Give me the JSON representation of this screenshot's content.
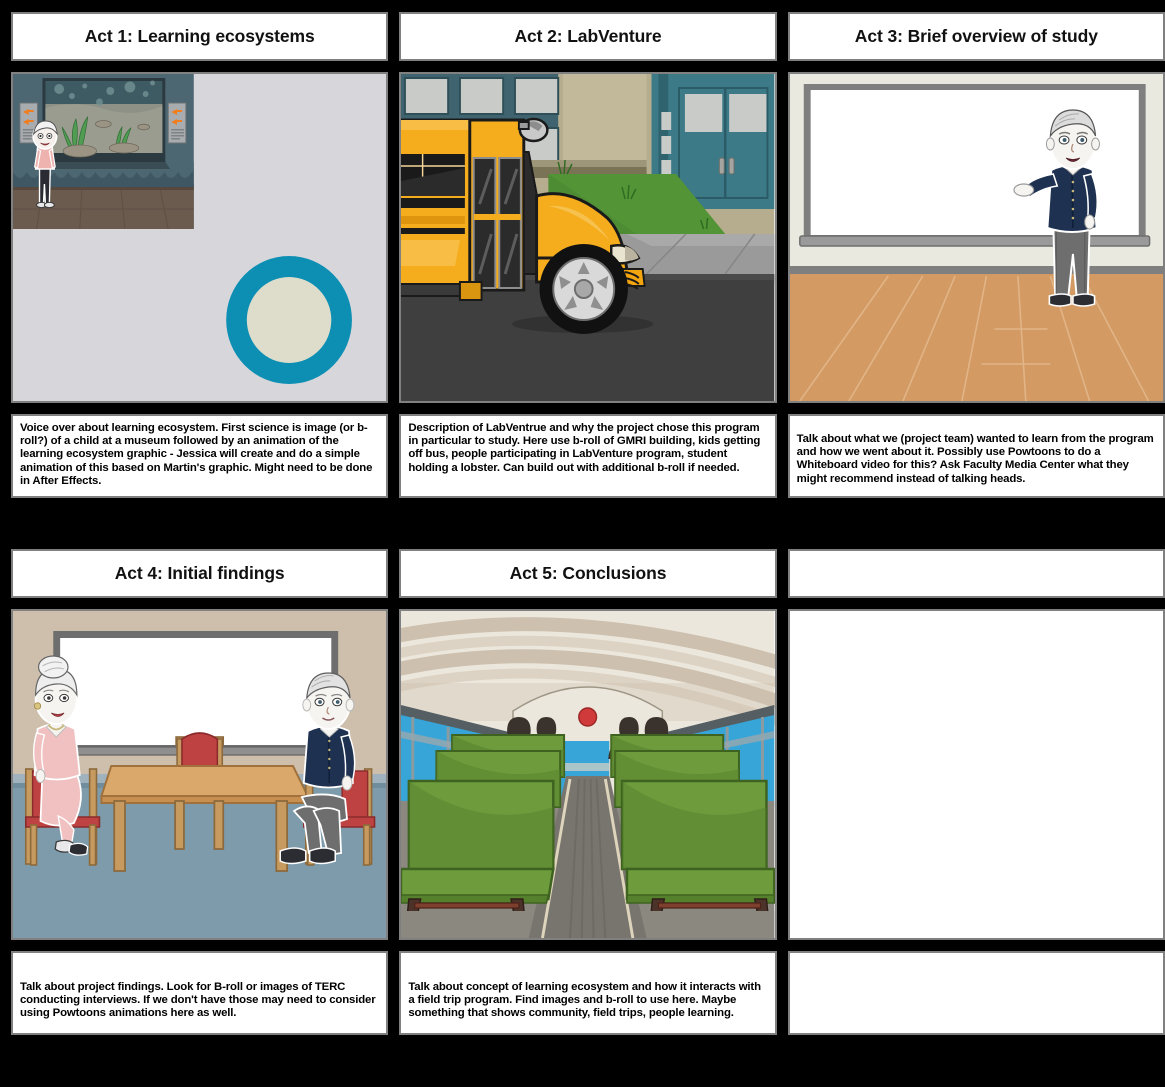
{
  "board": {
    "background_color": "#000000",
    "panel_border_color": "#808080",
    "panel_fill_color": "#ffffff",
    "columns": 3,
    "rows": 2
  },
  "panels": [
    {
      "index": 1,
      "title": "Act 1: Learning ecosystems",
      "scene_name": "museum-aquarium-scene",
      "caption": "Voice over about learning ecosystem. First science is image (or b-roll?) of a child at a museum followed by an animation of the learning ecosystem graphic - Jessica will create and do a simple animation of this based on Martin's graphic. Might need to be done in After Effects.",
      "scene_colors": {
        "backdrop": "#d7d7db",
        "wall": "#4c6672",
        "tank_water": "#8d9186",
        "tank_sky": "#3e5b63",
        "floor": "#6b5a4e",
        "donut_ring": "#0d8fb4",
        "donut_hole": "#dedcca",
        "sign": "#a8acaf",
        "fish_icon": "#f07d1e",
        "kelp": "#4f9c52",
        "child_shirt": "#eeb3ae",
        "child_pants": "#2b2b33",
        "child_hair": "#f2f2f2"
      }
    },
    {
      "index": 2,
      "title": "Act 2: LabVenture",
      "scene_name": "school-bus-exterior-scene",
      "caption": "Description of LabVentrue and why the project chose this program in particular to study. Here use b-roll of GMRI building, kids getting off bus, people participating in LabVenture program, student holding a lobster. Can build out with additional b-roll if needed.",
      "scene_colors": {
        "bus_body": "#f5ac1d",
        "bus_body_dark": "#e0950f",
        "bus_window": "#1a1a1a",
        "tire": "#111111",
        "hubcap": "#cfcfcf",
        "road": "#3f3f3f",
        "sidewalk": "#9a9a9a",
        "grass": "#4e8c34",
        "building_wall": "#b5ad8e",
        "building_trim": "#7b7356",
        "door": "#3d7a87",
        "window_glass": "#c9cbc9"
      }
    },
    {
      "index": 3,
      "title": "Act 3: Brief overview of study",
      "scene_name": "whiteboard-presenter-scene",
      "caption": "Talk about what we (project team) wanted to learn from the program and how we went about it. Possibly use Powtoons to do a Whiteboard video for this? Ask Faculty Media Center what they might recommend instead of talking heads.",
      "scene_colors": {
        "wall": "#e9e9df",
        "board_frame": "#7f7f7f",
        "board_face": "#ffffff",
        "floor": "#d39a63",
        "floor_line": "#e3b88c",
        "shirt": "#1e3150",
        "pants": "#6e6e6e",
        "shoes": "#2c2c33",
        "skin": "#f6f4f0",
        "hair": "#dcdcdc"
      }
    },
    {
      "index": 4,
      "title": "Act 4: Initial findings",
      "scene_name": "classroom-interview-table-scene",
      "caption": "Talk about project findings. Look for B-roll or images of TERC conducting interviews. If we don't have those may need to consider using Powtoons animations here as well.",
      "scene_colors": {
        "wall": "#cdbfab",
        "floor": "#7d9bab",
        "board_frame": "#6e6e6e",
        "board_face": "#ffffff",
        "table_top": "#d9a86a",
        "table_leg": "#c79a60",
        "chair_fabric": "#bf4242",
        "chair_wood": "#c79a60",
        "dress": "#f0c1c0",
        "jacket": "#1e3150",
        "pants": "#6e6e6e"
      }
    },
    {
      "index": 5,
      "title": "Act 5: Conclusions",
      "scene_name": "school-bus-interior-scene",
      "caption": "Talk about concept of learning ecosystem and how it interacts with a field trip program. Find images and b-roll to use here. Maybe something that shows community, field trips, people learning.",
      "scene_colors": {
        "ceiling": "#ece7dc",
        "ceiling_stripe": "#cdc0ae",
        "seat": "#6e9c3c",
        "seat_dark": "#55802c",
        "aisle": "#8b8880",
        "window_sky": "#38a5d8",
        "passenger": "#3a322c",
        "stop_light": "#d13a3a",
        "seat_leg": "#4c332a"
      }
    },
    {
      "index": 6,
      "title": "",
      "scene_name": "empty-scene",
      "caption": "",
      "scene_colors": {}
    }
  ]
}
